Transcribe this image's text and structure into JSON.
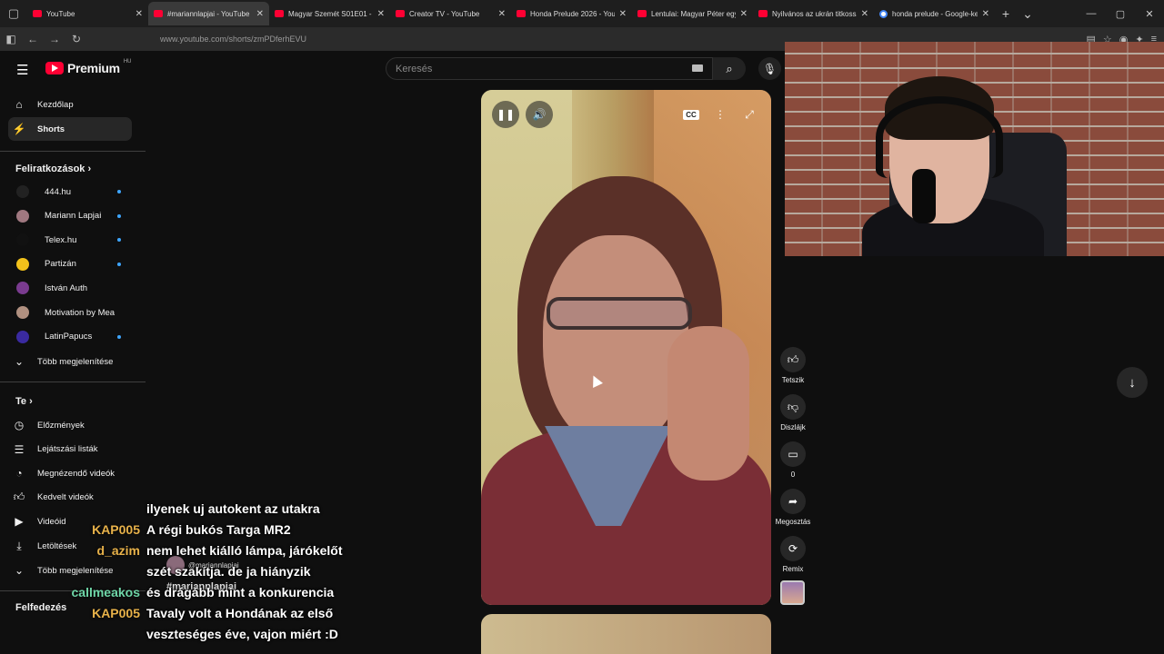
{
  "browser": {
    "tabs": [
      {
        "title": "YouTube",
        "icon": "youtube-icon"
      },
      {
        "title": "#mariannlapjai - YouTube",
        "icon": "youtube-icon"
      },
      {
        "title": "Magyar Szemét S01E01 - M",
        "icon": "youtube-icon"
      },
      {
        "title": "Creator TV - YouTube",
        "icon": "youtube-icon"
      },
      {
        "title": "Honda Prelude 2026 - YouT",
        "icon": "youtube-icon"
      },
      {
        "title": "Lentulai: Magyar Péter egy",
        "icon": "youtube-icon"
      },
      {
        "title": "Nyilvános az ukrán titkossz",
        "icon": "youtube-icon"
      },
      {
        "title": "honda prelude - Google-ke",
        "icon": "google-icon"
      }
    ],
    "url": "www.youtube.com/shorts/zmPDferhEVU"
  },
  "youtube": {
    "logo_text": "Premium",
    "logo_region": "HU",
    "search_placeholder": "Keresés"
  },
  "sidebar": {
    "top": [
      {
        "label": "Kezdőlap",
        "icon": "home-icon"
      },
      {
        "label": "Shorts",
        "icon": "shorts-icon"
      }
    ],
    "subs_title": "Feliratkozások",
    "subs": [
      {
        "label": "444.hu",
        "color": "#222222"
      },
      {
        "label": "Mariann Lapjai",
        "color": "#a07880"
      },
      {
        "label": "Telex.hu",
        "color": "#111111"
      },
      {
        "label": "Partizán",
        "color": "#f2c21b"
      },
      {
        "label": "István Auth",
        "color": "#7a3b8f"
      },
      {
        "label": "Motivation by Mea",
        "color": "#b09080"
      },
      {
        "label": "LatinPapucs",
        "color": "#3a2aa0"
      }
    ],
    "more_subs": "Több megjelenítése",
    "you_title": "Te",
    "you": [
      {
        "label": "Előzmények",
        "icon": "history-icon"
      },
      {
        "label": "Lejátszási listák",
        "icon": "playlist-icon"
      },
      {
        "label": "Megnézendő videók",
        "icon": "clock-icon"
      },
      {
        "label": "Kedvelt videók",
        "icon": "like-icon"
      },
      {
        "label": "Videóid",
        "icon": "video-icon"
      },
      {
        "label": "Letöltések",
        "icon": "download-icon"
      }
    ],
    "more_you": "Több megjelenítése",
    "explore_title": "Felfedezés"
  },
  "actions": {
    "like": "Tetszik",
    "dislike": "Diszlájk",
    "comments": "0",
    "share": "Megosztás",
    "remix": "Remix"
  },
  "overlay": {
    "handle": "@mariannlapjai",
    "hashtag": "#mariannlapjai"
  },
  "chat": [
    {
      "user": "",
      "text": "ilyenek uj autokent az utakra",
      "color": "#ffffff"
    },
    {
      "user": "KAP005",
      "text": "A régi bukós Targa MR2",
      "color": "#e8b24a"
    },
    {
      "user": "d_azim",
      "text": "nem lehet kiálló lámpa, járókelőt",
      "color": "#e8b24a"
    },
    {
      "user": "",
      "text": "szét szakítja. de ja hiányzik",
      "color": "#ffffff"
    },
    {
      "user": "callmeakos",
      "text": "és drágább mint a konkurencia",
      "color": "#6fd6a8"
    },
    {
      "user": "KAP005",
      "text": "Tavaly volt a Hondának az első",
      "color": "#e8b24a"
    },
    {
      "user": "",
      "text": "veszteséges éve, vajon miért :D",
      "color": "#ffffff"
    }
  ]
}
